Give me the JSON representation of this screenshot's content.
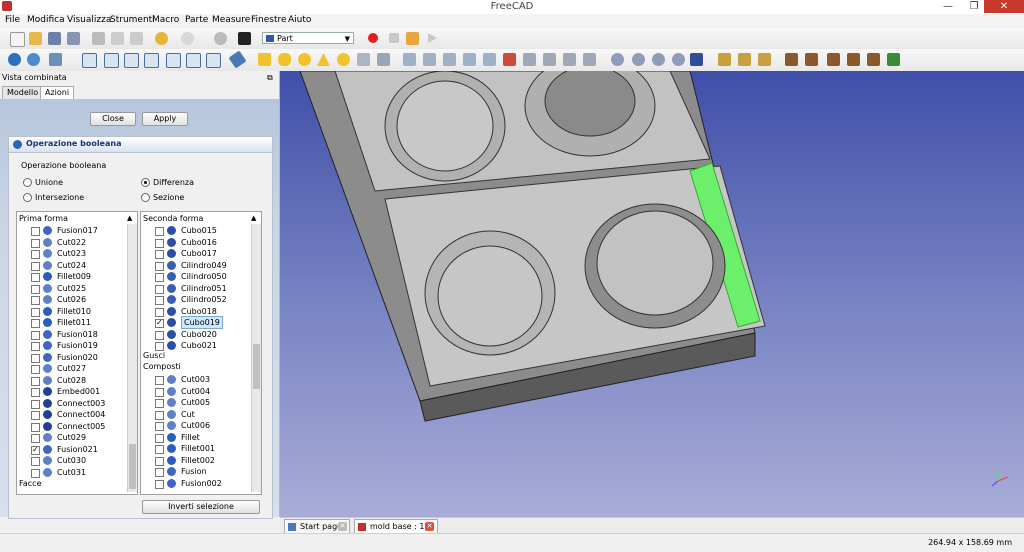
{
  "window": {
    "title": "FreeCAD",
    "min": "—",
    "max": "❐",
    "close": "✕"
  },
  "menu": [
    "File",
    "Modifica",
    "Visualizza",
    "Strumenti",
    "Macro",
    "Parte",
    "Measure",
    "Finestre",
    "Aiuto"
  ],
  "toolbar": {
    "workbench": "Part"
  },
  "panel": {
    "title": "Vista combinata",
    "tabs": [
      "Modello",
      "Azioni"
    ],
    "close_label": "Close",
    "apply_label": "Apply",
    "task_title": "Operazione booleana",
    "group_label": "Operazione booleana",
    "ops": [
      {
        "label": "Unione",
        "checked": false
      },
      {
        "label": "Differenza",
        "checked": true
      },
      {
        "label": "Intersezione",
        "checked": false
      },
      {
        "label": "Sezione",
        "checked": false
      }
    ],
    "first_shape": {
      "header": "Prima forma",
      "items": [
        {
          "name": "Fusion017",
          "checked": false
        },
        {
          "name": "Cut022",
          "checked": false
        },
        {
          "name": "Cut023",
          "checked": false
        },
        {
          "name": "Cut024",
          "checked": false
        },
        {
          "name": "Fillet009",
          "checked": false
        },
        {
          "name": "Cut025",
          "checked": false
        },
        {
          "name": "Cut026",
          "checked": false
        },
        {
          "name": "Fillet010",
          "checked": false
        },
        {
          "name": "Fillet011",
          "checked": false
        },
        {
          "name": "Fusion018",
          "checked": false
        },
        {
          "name": "Fusion019",
          "checked": false
        },
        {
          "name": "Fusion020",
          "checked": false
        },
        {
          "name": "Cut027",
          "checked": false
        },
        {
          "name": "Cut028",
          "checked": false
        },
        {
          "name": "Embed001",
          "checked": false
        },
        {
          "name": "Connect003",
          "checked": false
        },
        {
          "name": "Connect004",
          "checked": false
        },
        {
          "name": "Connect005",
          "checked": false
        },
        {
          "name": "Cut029",
          "checked": false
        },
        {
          "name": "Fusion021",
          "checked": true
        },
        {
          "name": "Cut030",
          "checked": false
        },
        {
          "name": "Cut031",
          "checked": false
        }
      ],
      "footer": "Facce"
    },
    "second_shape": {
      "header": "Seconda forma",
      "solids": [
        {
          "name": "Cubo015",
          "checked": false
        },
        {
          "name": "Cubo016",
          "checked": false
        },
        {
          "name": "Cubo017",
          "checked": false
        },
        {
          "name": "Cilindro049",
          "checked": false
        },
        {
          "name": "Cilindro050",
          "checked": false
        },
        {
          "name": "Cilindro051",
          "checked": false
        },
        {
          "name": "Cilindro052",
          "checked": false
        },
        {
          "name": "Cubo018",
          "checked": false
        },
        {
          "name": "Cubo019",
          "checked": true
        },
        {
          "name": "Cubo020",
          "checked": false
        },
        {
          "name": "Cubo021",
          "checked": false
        }
      ],
      "group_shells": "Gusci",
      "group_compounds": "Composti",
      "compounds": [
        {
          "name": "Cut003",
          "checked": false
        },
        {
          "name": "Cut004",
          "checked": false
        },
        {
          "name": "Cut005",
          "checked": false
        },
        {
          "name": "Cut",
          "checked": false
        },
        {
          "name": "Cut006",
          "checked": false
        },
        {
          "name": "Fillet",
          "checked": false
        },
        {
          "name": "Fillet001",
          "checked": false
        },
        {
          "name": "Fillet002",
          "checked": false
        },
        {
          "name": "Fusion",
          "checked": false
        },
        {
          "name": "Fusion002",
          "checked": false
        }
      ]
    },
    "invert_label": "Inverti selezione"
  },
  "doc_tabs": [
    {
      "label": "Start page"
    },
    {
      "label": "mold base : 1*"
    }
  ],
  "status": {
    "dimensions": "264.94 x 158.69 mm"
  },
  "colors": {
    "viewport_top": "#3f4fa9",
    "viewport_bottom": "#a9acd7",
    "selection": "#6cf06c",
    "accent": "#17357a"
  }
}
